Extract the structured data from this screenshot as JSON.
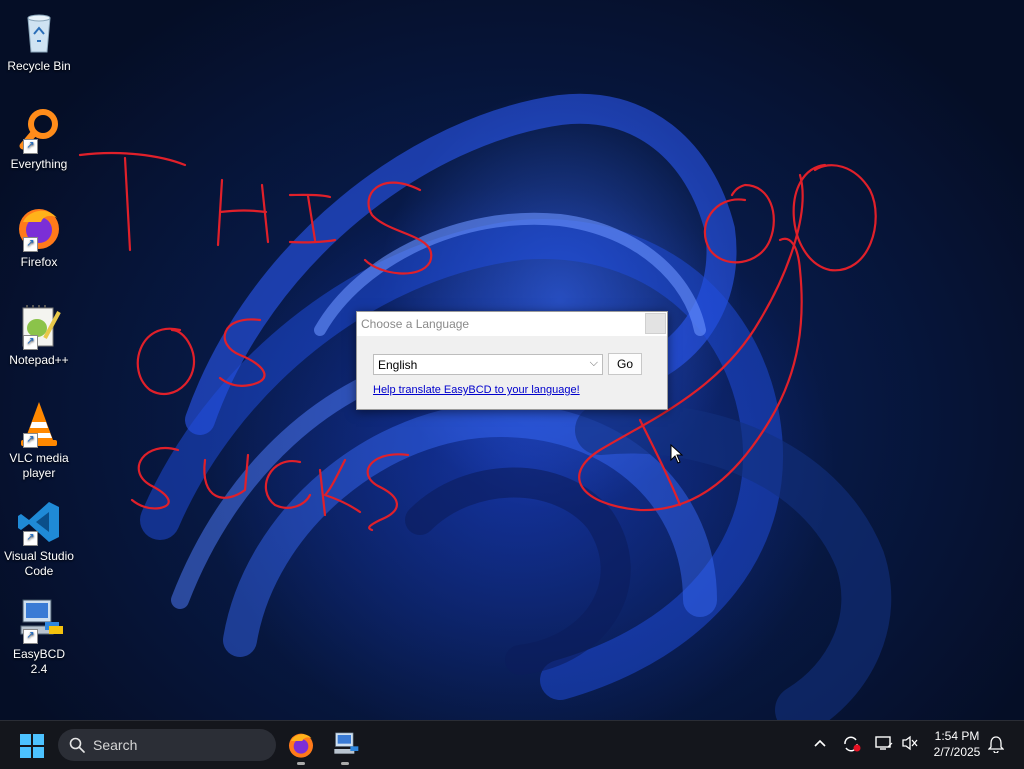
{
  "desktop": {
    "icons": [
      {
        "label": "Recycle Bin",
        "icon": "recycle-bin-icon"
      },
      {
        "label": "Everything",
        "icon": "everything-search-icon"
      },
      {
        "label": "Firefox",
        "icon": "firefox-icon"
      },
      {
        "label": "Notepad++",
        "icon": "notepad-plus-plus-icon"
      },
      {
        "label": "VLC media player",
        "icon": "vlc-icon"
      },
      {
        "label": "Visual Studio Code",
        "icon": "vscode-icon"
      },
      {
        "label": "EasyBCD 2.4",
        "icon": "easybcd-icon"
      }
    ],
    "scribble_color": "#e0202a"
  },
  "dialog": {
    "title": "Choose a Language",
    "language_selected": "English",
    "go_label": "Go",
    "help_link": "Help translate EasyBCD to your language!"
  },
  "taskbar": {
    "search_label": "Search",
    "time": "1:54 PM",
    "date": "2/7/2025",
    "accent": "#1e90ff"
  }
}
